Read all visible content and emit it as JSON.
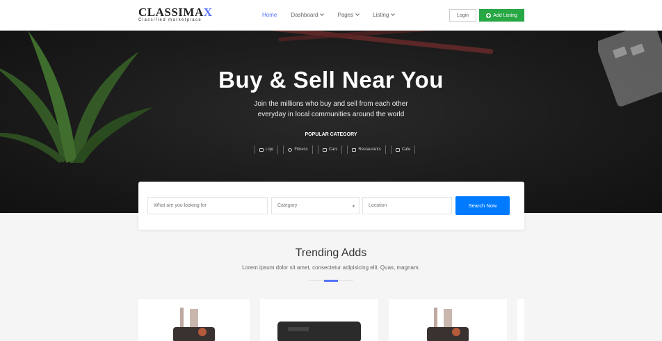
{
  "brand": {
    "name_main": "CLASSIMA",
    "name_accent": "X",
    "tagline": "Classified marketplace"
  },
  "nav": {
    "items": [
      {
        "label": "Home",
        "active": true,
        "dropdown": false
      },
      {
        "label": "Dashboard",
        "active": false,
        "dropdown": true
      },
      {
        "label": "Pages",
        "active": false,
        "dropdown": true
      },
      {
        "label": "Listing",
        "active": false,
        "dropdown": true
      }
    ],
    "login_label": "Login",
    "add_listing_label": "Add Listing"
  },
  "hero": {
    "title": "Buy & Sell Near You",
    "subtitle_line1": "Join the millions who buy and sell from each other",
    "subtitle_line2": "everyday in local communities around the world",
    "popular_label": "POPULAR CATEGORY",
    "categories": [
      {
        "label": "Loje",
        "icon": "bed-icon"
      },
      {
        "label": "Fitness",
        "icon": "dribbble-icon"
      },
      {
        "label": "Cars",
        "icon": "car-icon"
      },
      {
        "label": "Restaurants",
        "icon": "restaurant-icon"
      },
      {
        "label": "Cafe",
        "icon": "coffee-icon"
      }
    ]
  },
  "search": {
    "what_placeholder": "What are you looking for",
    "category_value": "Category",
    "location_placeholder": "Location",
    "button_label": "Search Now"
  },
  "trending": {
    "title": "Trending Adds",
    "subtitle": "Lorem ipsum dolor sit amet, consectetur adipisicing elit. Quas, magnam."
  },
  "colors": {
    "accent": "#5672f9",
    "green": "#28a745",
    "search_blue": "#007bff"
  }
}
